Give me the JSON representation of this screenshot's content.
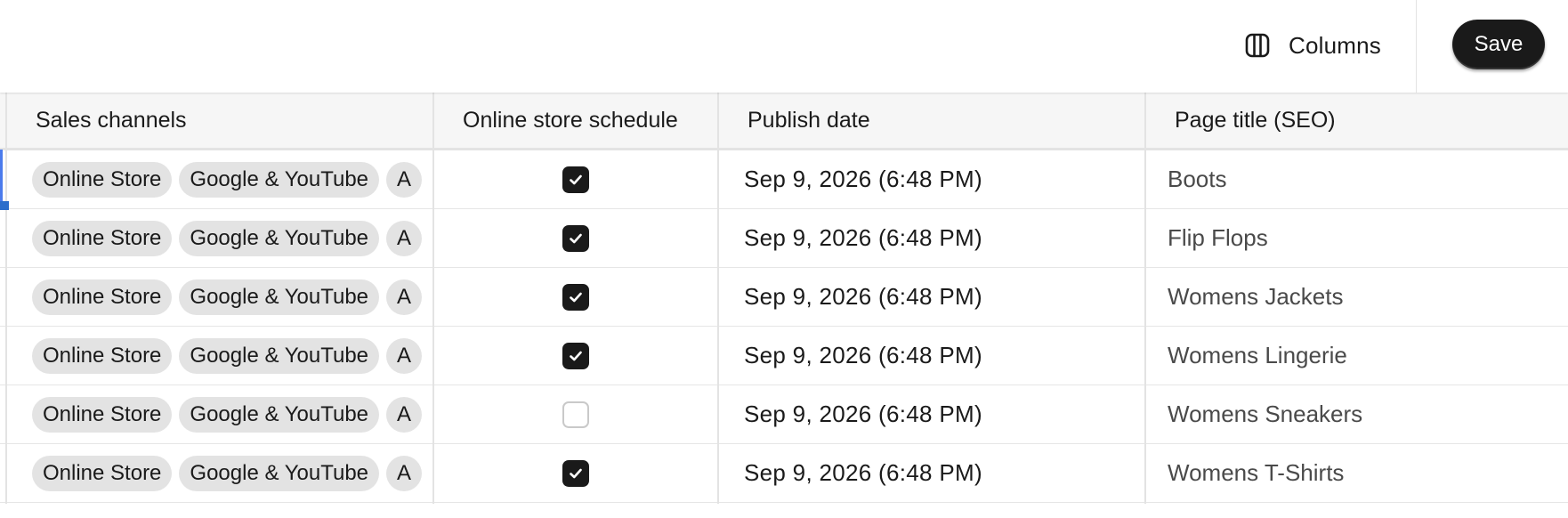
{
  "toolbar": {
    "columns_label": "Columns",
    "save_label": "Save",
    "columns_icon": "columns-icon"
  },
  "table": {
    "headers": {
      "sales_channels": "Sales channels",
      "online_store_schedule": "Online store schedule",
      "publish_date": "Publish date",
      "page_title": "Page title (SEO)"
    },
    "rows": [
      {
        "channels": [
          "Online Store",
          "Google & YouTube",
          "A"
        ],
        "scheduled": true,
        "publish_date": "Sep 9, 2026 (6:48 PM)",
        "page_title": "Boots"
      },
      {
        "channels": [
          "Online Store",
          "Google & YouTube",
          "A"
        ],
        "scheduled": true,
        "publish_date": "Sep 9, 2026 (6:48 PM)",
        "page_title": "Flip Flops"
      },
      {
        "channels": [
          "Online Store",
          "Google & YouTube",
          "A"
        ],
        "scheduled": true,
        "publish_date": "Sep 9, 2026 (6:48 PM)",
        "page_title": "Womens Jackets"
      },
      {
        "channels": [
          "Online Store",
          "Google & YouTube",
          "A"
        ],
        "scheduled": true,
        "publish_date": "Sep 9, 2026 (6:48 PM)",
        "page_title": "Womens Lingerie"
      },
      {
        "channels": [
          "Online Store",
          "Google & YouTube",
          "A"
        ],
        "scheduled": false,
        "publish_date": "Sep 9, 2026 (6:48 PM)",
        "page_title": "Womens Sneakers"
      },
      {
        "channels": [
          "Online Store",
          "Google & YouTube",
          "A"
        ],
        "scheduled": true,
        "publish_date": "Sep 9, 2026 (6:48 PM)",
        "page_title": "Womens T-Shirts"
      }
    ]
  },
  "colors": {
    "accent": "#2c6ecb",
    "chip_bg": "#e3e3e3",
    "checkbox_on": "#1a1a1a",
    "header_bg": "#f6f6f6"
  }
}
